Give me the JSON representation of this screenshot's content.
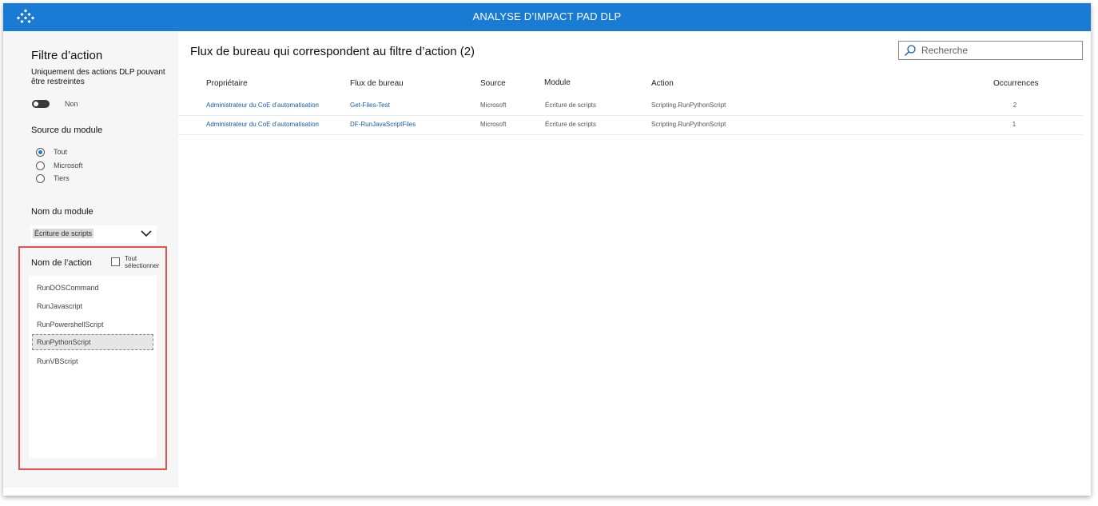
{
  "header": {
    "title": "ANALYSE D’IMPACT PAD DLP",
    "logo_icon": "diamond-pattern-logo-icon",
    "background": "#1a7bd4"
  },
  "sidebar": {
    "title": "Filtre d’action",
    "subtitle": "Uniquement des actions DLP pouvant être restreintes",
    "toggle": {
      "label": "Non",
      "on": false
    },
    "module_source": {
      "label": "Source du module",
      "options": [
        "Tout",
        "Microsoft",
        "Tiers"
      ],
      "selected": "Tout"
    },
    "module_name": {
      "label": "Nom du module",
      "selected": "Écriture de scripts"
    },
    "action_name": {
      "label": "Nom de l’action",
      "select_all_line1": "Tout",
      "select_all_line2": "sélectionner",
      "items": [
        "RunDOSCommand",
        "RunJavascript",
        "RunPowershellScript",
        "RunPythonScript",
        "RunVBScript"
      ],
      "selected": "RunPythonScript"
    }
  },
  "main": {
    "title": "Flux de bureau qui correspondent au filtre d’action (2)",
    "search": {
      "placeholder": "Recherche",
      "value": ""
    },
    "columns": [
      "Propriétaire",
      "Flux de bureau",
      "Source",
      "Module",
      "Action",
      "Occurrences"
    ],
    "rows": [
      [
        "Administrateur du CoE d’automatisation",
        "Get-Files-Test",
        "Microsoft",
        "Écriture de scripts",
        "Scripting.RunPythonScript",
        "2"
      ],
      [
        "Administrateur du CoE d’automatisation",
        "DF-RunJavaScriptFiles",
        "Microsoft",
        "Écriture de scripts",
        "Scripting.RunPythonScript",
        "1"
      ]
    ]
  },
  "colors": {
    "accent": "#1a7bd4",
    "link": "#1a5aa6",
    "highlight_border": "#e05252"
  }
}
